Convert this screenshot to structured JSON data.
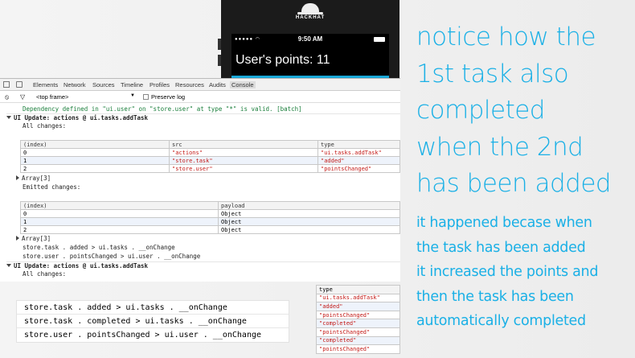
{
  "phone": {
    "brand": "HACKHAT",
    "status_time": "9:50 AM",
    "points_text": "User's points: 11"
  },
  "devtools": {
    "tabs": [
      "Elements",
      "Network",
      "Sources",
      "Timeline",
      "Profiles",
      "Resources",
      "Audits",
      "Console"
    ],
    "active_tab": "Console",
    "frame_select": "<top frame>",
    "preserve_log_label": "Preserve log",
    "log": {
      "dependency": "Dependency defined in \"ui.user\" on \"store.user\" at type \"*\" is valid. [batch]",
      "ui_update_1": "UI Update: actions @ ui.tasks.addTask",
      "all_changes_1": "All changes:",
      "array_1": "Array[3]",
      "emitted_changes": "Emitted changes:",
      "array_2": "Array[3]",
      "flow_1": "store.task . added > ui.tasks . __onChange",
      "flow_2": "store.user . pointsChanged > ui.user . __onChange",
      "ui_update_2": "UI Update: actions @ ui.tasks.addTask",
      "all_changes_2": "All changes:"
    },
    "changes_table": {
      "headers": [
        "(index)",
        "src",
        "type"
      ],
      "rows": [
        [
          "0",
          "\"actions\"",
          "\"ui.tasks.addTask\""
        ],
        [
          "1",
          "\"store.task\"",
          "\"added\""
        ],
        [
          "2",
          "\"store.user\"",
          "\"pointsChanged\""
        ]
      ]
    },
    "emitted_table": {
      "headers": [
        "(index)",
        "payload"
      ],
      "rows": [
        [
          "0",
          "Object"
        ],
        [
          "1",
          "Object"
        ],
        [
          "2",
          "Object"
        ]
      ]
    }
  },
  "zoom_commands": [
    "store.task . added > ui.tasks . __onChange",
    "store.task . completed > ui.tasks . __onChange",
    "store.user . pointsChanged > ui.user . __onChange"
  ],
  "zoom_type_table": {
    "header": "type",
    "rows": [
      "\"ui.tasks.addTask\"",
      "\"added\"",
      "\"pointsChanged\"",
      "\"completed\"",
      "\"pointsChanged\"",
      "\"completed\"",
      "\"pointsChanged\""
    ]
  },
  "annotation": {
    "headline": [
      "notice how the",
      "1st task also",
      "completed",
      "when the 2nd",
      "has been added"
    ],
    "explanation": [
      "it happened becase when",
      "the task has been added",
      "it increased the points and",
      "then the task has been",
      "automatically completed"
    ]
  },
  "colors": {
    "accent": "#1ab0e6",
    "string_red": "#c41a16",
    "dependency_green": "#1b7f3c"
  }
}
